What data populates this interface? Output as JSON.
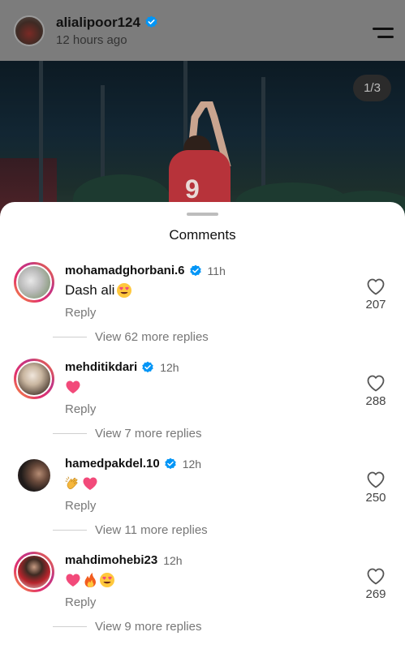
{
  "header": {
    "username": "alialipoor124",
    "subtitle": "12 hours ago",
    "verified": true
  },
  "photo": {
    "counter": "1/3"
  },
  "sheet": {
    "title": "Comments"
  },
  "comments": [
    {
      "username": "mohamadghorbani.6",
      "verified": true,
      "time": "11h",
      "text": "Dash ali",
      "emojis": [
        "heart-eyes"
      ],
      "reply_label": "Reply",
      "more_replies": "View 62 more replies",
      "likes": "207"
    },
    {
      "username": "mehditikdari",
      "verified": true,
      "time": "12h",
      "text": "",
      "emojis": [
        "pink-heart"
      ],
      "reply_label": "Reply",
      "more_replies": "View 7 more replies",
      "likes": "288"
    },
    {
      "username": "hamedpakdel.10",
      "verified": true,
      "time": "12h",
      "text": "",
      "emojis": [
        "clapping-hands",
        "pink-heart"
      ],
      "reply_label": "Reply",
      "more_replies": "View 11 more replies",
      "likes": "250"
    },
    {
      "username": "mahdimohebi23",
      "verified": false,
      "time": "12h",
      "text": "",
      "emojis": [
        "pink-heart",
        "fire",
        "heart-eyes"
      ],
      "reply_label": "Reply",
      "more_replies": "View 9 more replies",
      "likes": "269"
    }
  ],
  "colors": {
    "verified_blue": "#0095f6",
    "emoji_heart": "#f24a7a",
    "emoji_face": "#ffc83d"
  }
}
